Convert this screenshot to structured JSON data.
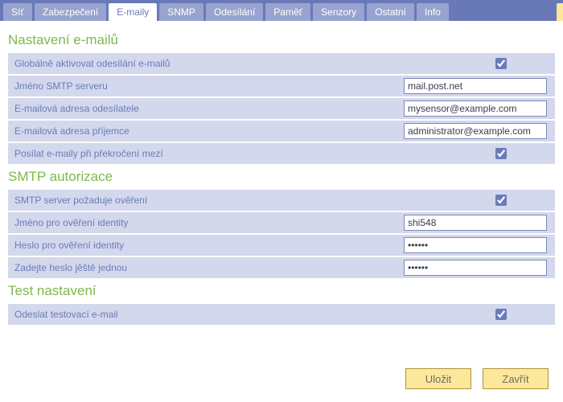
{
  "tabs": {
    "items": [
      {
        "label": "Síť",
        "active": false
      },
      {
        "label": "Zabezpečení",
        "active": false
      },
      {
        "label": "E-maily",
        "active": true
      },
      {
        "label": "SNMP",
        "active": false
      },
      {
        "label": "Odesílání",
        "active": false
      },
      {
        "label": "Paměť",
        "active": false
      },
      {
        "label": "Senzory",
        "active": false
      },
      {
        "label": "Ostatní",
        "active": false
      },
      {
        "label": "Info",
        "active": false
      }
    ]
  },
  "section_email": {
    "title": "Nastavení e-mailů",
    "enable_label": "Globálně aktivovat odesílání e-mailů",
    "enable_checked": true,
    "smtp_server_label": "Jméno SMTP serveru",
    "smtp_server_value": "mail.post.net",
    "sender_label": "E-mailová adresa odesílatele",
    "sender_value": "mysensor@example.com",
    "recipient_label": "E-mailová adresa příjemce",
    "recipient_value": "administrator@example.com",
    "threshold_label": "Posílat e-maily při překročení mezí",
    "threshold_checked": true
  },
  "section_auth": {
    "title": "SMTP autorizace",
    "require_label": "SMTP server požaduje ověření",
    "require_checked": true,
    "username_label": "Jméno pro ověření identity",
    "username_value": "shi548",
    "password_label": "Heslo pro ověření identity",
    "password_value": "••••••",
    "password2_label": "Zadejte heslo jěště jednou",
    "password2_value": "••••••"
  },
  "section_test": {
    "title": "Test nastavení",
    "send_label": "Odeslat testovací e-mail",
    "send_checked": true
  },
  "footer": {
    "save": "Uložit",
    "close": "Zavřít"
  }
}
